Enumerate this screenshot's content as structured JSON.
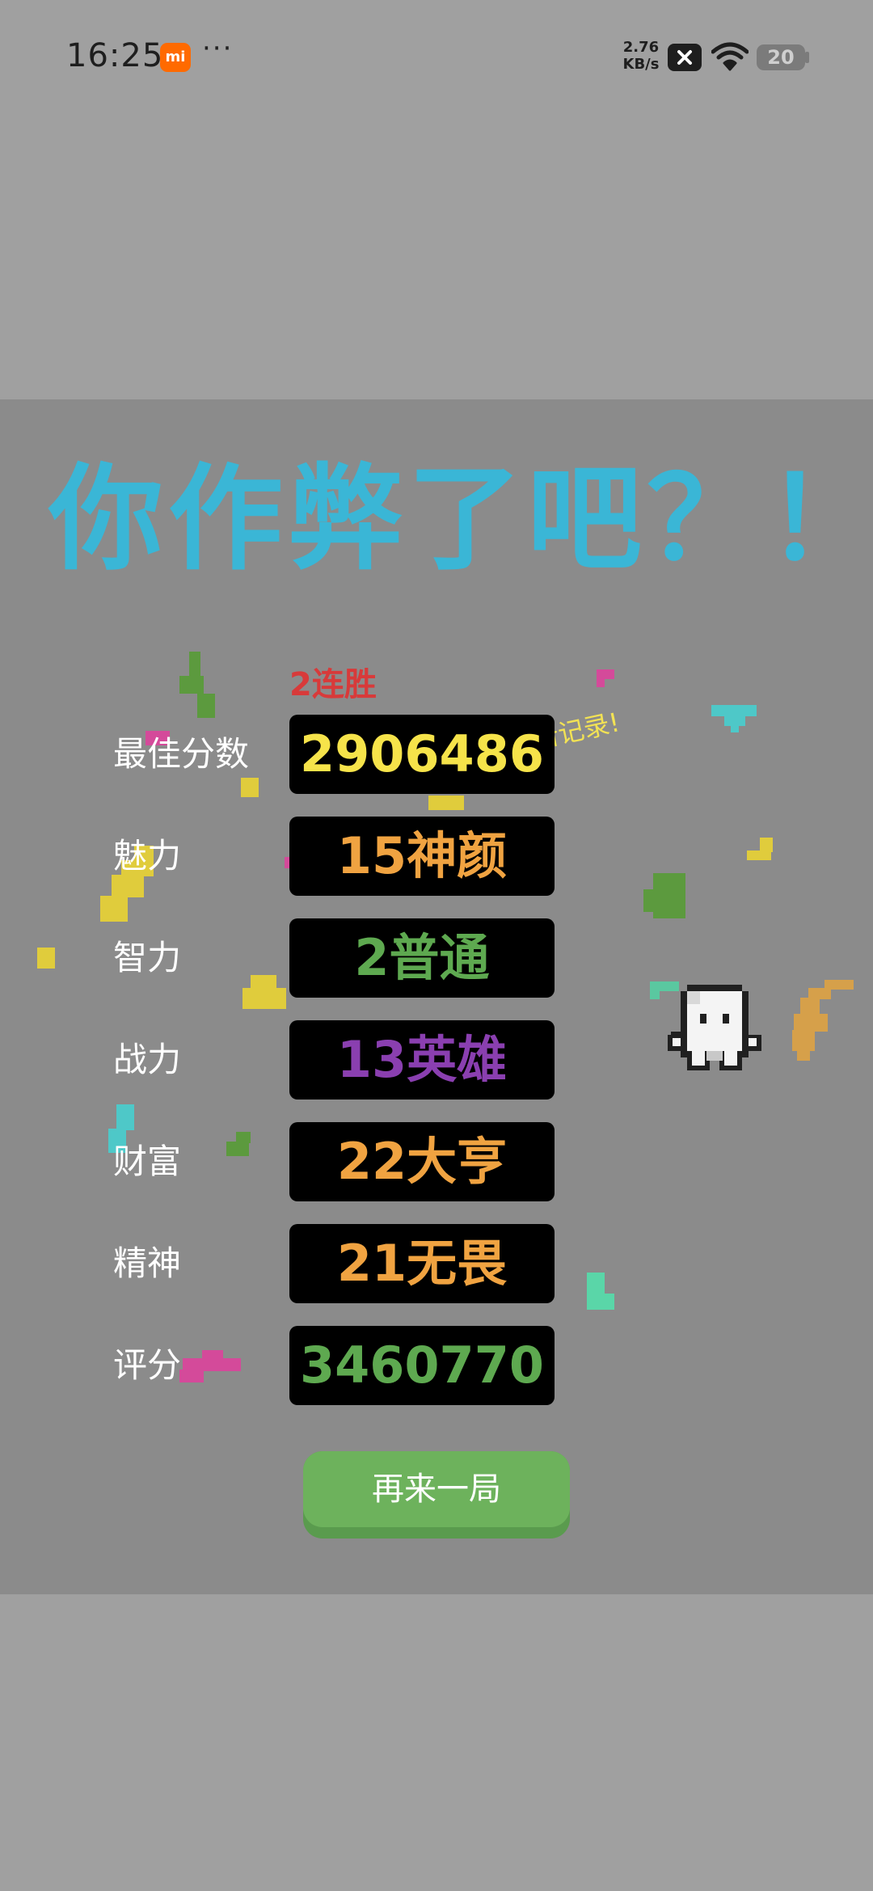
{
  "status_bar": {
    "time": "16:25",
    "app_badge": "mi",
    "more": "···",
    "net_speed_value": "2.76",
    "net_speed_unit": "KB/s",
    "battery": "20"
  },
  "game": {
    "title": "你作弊了吧？！",
    "streak": "2连胜",
    "new_record": "新记录!",
    "stats": [
      {
        "label": "最佳分数",
        "value": "2906486",
        "color": "#f6e34a"
      },
      {
        "label": "魅力",
        "value": "15神颜",
        "color": "#f0a341"
      },
      {
        "label": "智力",
        "value": "2普通",
        "color": "#5ea950"
      },
      {
        "label": "战力",
        "value": "13英雄",
        "color": "#8a3fb0"
      },
      {
        "label": "财富",
        "value": "22大亨",
        "color": "#f0a341"
      },
      {
        "label": "精神",
        "value": "21无畏",
        "color": "#f0a341"
      },
      {
        "label": "评分",
        "value": "3460770",
        "color": "#5ea950"
      }
    ],
    "play_again": "再来一局"
  },
  "colors": {
    "page_bg": "#a0a0a0",
    "panel_bg": "#8b8b8b",
    "title": "#3ab6d6",
    "streak": "#d83a3a",
    "new_record": "#f2e254",
    "button": "#6db25c"
  }
}
